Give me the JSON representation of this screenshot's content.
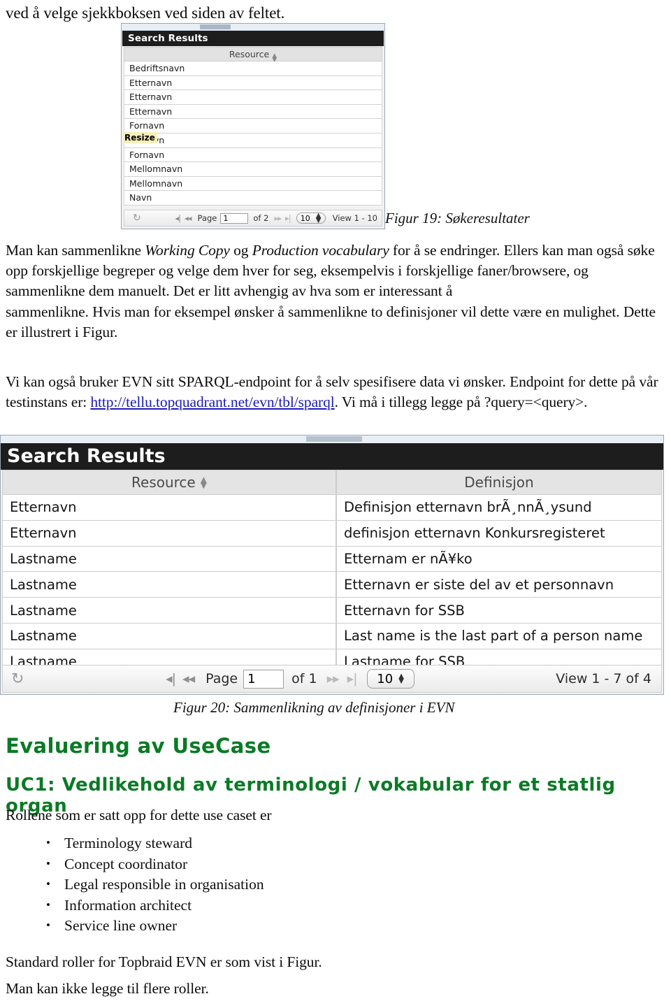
{
  "document": {
    "intro_line": "ved å velge sjekkboksen ved siden av feltet.",
    "paragraph_1": {
      "part1": "Man kan sammenlikne ",
      "italic1": "Working Copy",
      "part2": " og ",
      "italic2": "Production vocabulary",
      "part3": " for å se endringer. Ellers kan man også søke opp forskjellige begreper og velge dem hver for seg, eksempelvis i forskjellige faner/browsere, og sammenlikne dem manuelt. Det er litt avhengig av hva som er interessant å"
    },
    "paragraph_2": "sammenlikne. Hvis man for eksempel ønsker å sammenlikne to definisjoner vil dette være en mulighet. Dette er illustrert i  Figur.",
    "paragraph_3": {
      "part1": "Vi kan også bruker EVN sitt SPARQL-endpoint for å selv spesifisere data vi ønsker. Endpoint for dette på vår testinstans er: ",
      "link_text": "http://tellu.topquadrant.net/evn/tbl/sparql",
      "part2": ". Vi må i tillegg legge på ?query=<query>."
    },
    "caption_19": "Figur 19: Søkeresultater",
    "caption_20": "Figur 20: Sammenlikning av definisjoner i EVN",
    "heading_evaluering": "Evaluering av UseCase",
    "heading_uc1": "UC1: Vedlikehold av terminologi / vokabular for et statlig organ",
    "paragraph_roles": "Rollene som er satt opp for dette use caset er",
    "roles": [
      "Terminology steward",
      "Concept coordinator",
      "Legal responsible in organisation",
      "Information architect",
      "Service line owner"
    ],
    "paragraph_standard": "Standard roller for Topbraid EVN er som vist i  Figur.",
    "paragraph_last": "Man kan ikke legge til flere roller."
  },
  "figure19": {
    "title": "Search Results",
    "column_header": "Resource",
    "sort_icon": "sort-arrows-icon",
    "tooltip": "Resize",
    "rows": [
      "Bedriftsnavn",
      "Etternavn",
      "Etternavn",
      "Etternavn",
      "Fornavn",
      "Fornavn",
      "Fornavn",
      "Mellomnavn",
      "Mellomnavn",
      "Navn"
    ],
    "footer": {
      "refresh_icon": "refresh-icon",
      "first_icon": "first-page-icon",
      "prev_icon": "previous-page-icon",
      "page_label": "Page",
      "page_value": "1",
      "of_label": "of 2",
      "next_icon": "next-page-icon",
      "last_icon": "last-page-icon",
      "page_size": "10",
      "view_label": "View 1 - 10"
    }
  },
  "figure20": {
    "title": "Search Results",
    "columns": [
      "Resource",
      "Definisjon"
    ],
    "sort_icon": "sort-arrows-icon",
    "rows": [
      {
        "resource": "Etternavn",
        "definisjon": "Definisjon etternavn brÃ¸nnÃ¸ysund"
      },
      {
        "resource": "Etternavn",
        "definisjon": "definisjon etternavn Konkursregisteret"
      },
      {
        "resource": "Lastname",
        "definisjon": "Etternam er nÃ¥ko"
      },
      {
        "resource": "Lastname",
        "definisjon": "Etternavn er siste del av et personnavn"
      },
      {
        "resource": "Lastname",
        "definisjon": "Etternavn for SSB"
      },
      {
        "resource": "Lastname",
        "definisjon": "Last name is the last part of a person name"
      },
      {
        "resource": "Lastname",
        "definisjon": "Lastname for SSB"
      }
    ],
    "footer": {
      "refresh_icon": "refresh-icon",
      "first_icon": "first-page-icon",
      "prev_icon": "previous-page-icon",
      "page_label": "Page",
      "page_value": "1",
      "of_label": "of 1",
      "next_icon": "next-page-icon",
      "last_icon": "last-page-icon",
      "page_size": "10",
      "view_label": "View 1 - 7 of 4"
    }
  },
  "colors": {
    "heading_green": "#0b7a25",
    "link_blue": "#1a1ab4",
    "titlebar_black": "#1d1d1d"
  }
}
